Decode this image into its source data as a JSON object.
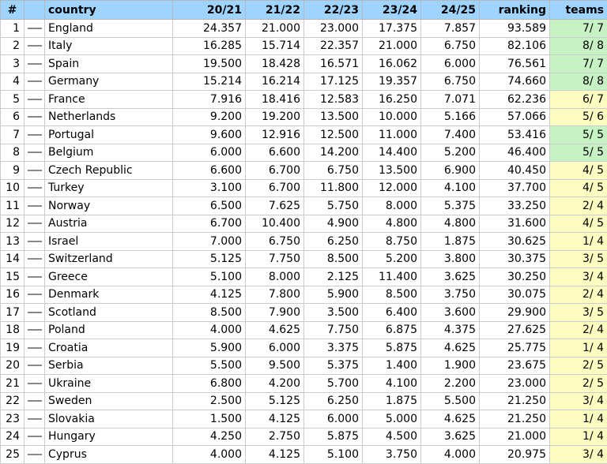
{
  "header": {
    "idx": "#",
    "country": "country",
    "s1": "20/21",
    "s2": "21/22",
    "s3": "22/23",
    "s4": "23/24",
    "s5": "24/25",
    "ranking": "ranking",
    "teams": "teams"
  },
  "colors": {
    "header": "#9fd4ff",
    "teams_green": "#c7f2c4",
    "teams_yellow": "#fdfdc2"
  },
  "trend_icon": "dash-icon",
  "rows": [
    {
      "idx": "1",
      "country": "England",
      "s1": "24.357",
      "s2": "21.000",
      "s3": "23.000",
      "s4": "17.375",
      "s5": "7.857",
      "ranking": "93.589",
      "teams": "7/ 7",
      "tc": "green"
    },
    {
      "idx": "2",
      "country": "Italy",
      "s1": "16.285",
      "s2": "15.714",
      "s3": "22.357",
      "s4": "21.000",
      "s5": "6.750",
      "ranking": "82.106",
      "teams": "8/ 8",
      "tc": "green"
    },
    {
      "idx": "3",
      "country": "Spain",
      "s1": "19.500",
      "s2": "18.428",
      "s3": "16.571",
      "s4": "16.062",
      "s5": "6.000",
      "ranking": "76.561",
      "teams": "7/ 7",
      "tc": "green"
    },
    {
      "idx": "4",
      "country": "Germany",
      "s1": "15.214",
      "s2": "16.214",
      "s3": "17.125",
      "s4": "19.357",
      "s5": "6.750",
      "ranking": "74.660",
      "teams": "8/ 8",
      "tc": "green"
    },
    {
      "idx": "5",
      "country": "France",
      "s1": "7.916",
      "s2": "18.416",
      "s3": "12.583",
      "s4": "16.250",
      "s5": "7.071",
      "ranking": "62.236",
      "teams": "6/ 7",
      "tc": "yellow"
    },
    {
      "idx": "6",
      "country": "Netherlands",
      "s1": "9.200",
      "s2": "19.200",
      "s3": "13.500",
      "s4": "10.000",
      "s5": "5.166",
      "ranking": "57.066",
      "teams": "5/ 6",
      "tc": "yellow"
    },
    {
      "idx": "7",
      "country": "Portugal",
      "s1": "9.600",
      "s2": "12.916",
      "s3": "12.500",
      "s4": "11.000",
      "s5": "7.400",
      "ranking": "53.416",
      "teams": "5/ 5",
      "tc": "green"
    },
    {
      "idx": "8",
      "country": "Belgium",
      "s1": "6.000",
      "s2": "6.600",
      "s3": "14.200",
      "s4": "14.400",
      "s5": "5.200",
      "ranking": "46.400",
      "teams": "5/ 5",
      "tc": "green"
    },
    {
      "idx": "9",
      "country": "Czech Republic",
      "s1": "6.600",
      "s2": "6.700",
      "s3": "6.750",
      "s4": "13.500",
      "s5": "6.900",
      "ranking": "40.450",
      "teams": "4/ 5",
      "tc": "yellow"
    },
    {
      "idx": "10",
      "country": "Turkey",
      "s1": "3.100",
      "s2": "6.700",
      "s3": "11.800",
      "s4": "12.000",
      "s5": "4.100",
      "ranking": "37.700",
      "teams": "4/ 5",
      "tc": "yellow"
    },
    {
      "idx": "11",
      "country": "Norway",
      "s1": "6.500",
      "s2": "7.625",
      "s3": "5.750",
      "s4": "8.000",
      "s5": "5.375",
      "ranking": "33.250",
      "teams": "2/ 4",
      "tc": "yellow"
    },
    {
      "idx": "12",
      "country": "Austria",
      "s1": "6.700",
      "s2": "10.400",
      "s3": "4.900",
      "s4": "4.800",
      "s5": "4.800",
      "ranking": "31.600",
      "teams": "4/ 5",
      "tc": "yellow"
    },
    {
      "idx": "13",
      "country": "Israel",
      "s1": "7.000",
      "s2": "6.750",
      "s3": "6.250",
      "s4": "8.750",
      "s5": "1.875",
      "ranking": "30.625",
      "teams": "1/ 4",
      "tc": "yellow"
    },
    {
      "idx": "14",
      "country": "Switzerland",
      "s1": "5.125",
      "s2": "7.750",
      "s3": "8.500",
      "s4": "5.200",
      "s5": "3.800",
      "ranking": "30.375",
      "teams": "3/ 5",
      "tc": "yellow"
    },
    {
      "idx": "15",
      "country": "Greece",
      "s1": "5.100",
      "s2": "8.000",
      "s3": "2.125",
      "s4": "11.400",
      "s5": "3.625",
      "ranking": "30.250",
      "teams": "3/ 4",
      "tc": "yellow"
    },
    {
      "idx": "16",
      "country": "Denmark",
      "s1": "4.125",
      "s2": "7.800",
      "s3": "5.900",
      "s4": "8.500",
      "s5": "3.750",
      "ranking": "30.075",
      "teams": "2/ 4",
      "tc": "yellow"
    },
    {
      "idx": "17",
      "country": "Scotland",
      "s1": "8.500",
      "s2": "7.900",
      "s3": "3.500",
      "s4": "6.400",
      "s5": "3.600",
      "ranking": "29.900",
      "teams": "3/ 5",
      "tc": "yellow"
    },
    {
      "idx": "18",
      "country": "Poland",
      "s1": "4.000",
      "s2": "4.625",
      "s3": "7.750",
      "s4": "6.875",
      "s5": "4.375",
      "ranking": "27.625",
      "teams": "2/ 4",
      "tc": "yellow"
    },
    {
      "idx": "19",
      "country": "Croatia",
      "s1": "5.900",
      "s2": "6.000",
      "s3": "3.375",
      "s4": "5.875",
      "s5": "4.625",
      "ranking": "25.775",
      "teams": "1/ 4",
      "tc": "yellow"
    },
    {
      "idx": "20",
      "country": "Serbia",
      "s1": "5.500",
      "s2": "9.500",
      "s3": "5.375",
      "s4": "1.400",
      "s5": "1.900",
      "ranking": "23.675",
      "teams": "2/ 5",
      "tc": "yellow"
    },
    {
      "idx": "21",
      "country": "Ukraine",
      "s1": "6.800",
      "s2": "4.200",
      "s3": "5.700",
      "s4": "4.100",
      "s5": "2.200",
      "ranking": "23.000",
      "teams": "2/ 5",
      "tc": "yellow"
    },
    {
      "idx": "22",
      "country": "Sweden",
      "s1": "2.500",
      "s2": "5.125",
      "s3": "6.250",
      "s4": "1.875",
      "s5": "5.500",
      "ranking": "21.250",
      "teams": "3/ 4",
      "tc": "yellow"
    },
    {
      "idx": "23",
      "country": "Slovakia",
      "s1": "1.500",
      "s2": "4.125",
      "s3": "6.000",
      "s4": "5.000",
      "s5": "4.625",
      "ranking": "21.250",
      "teams": "1/ 4",
      "tc": "yellow"
    },
    {
      "idx": "24",
      "country": "Hungary",
      "s1": "4.250",
      "s2": "2.750",
      "s3": "5.875",
      "s4": "4.500",
      "s5": "3.625",
      "ranking": "21.000",
      "teams": "1/ 4",
      "tc": "yellow"
    },
    {
      "idx": "25",
      "country": "Cyprus",
      "s1": "4.000",
      "s2": "4.125",
      "s3": "5.100",
      "s4": "3.750",
      "s5": "4.000",
      "ranking": "20.975",
      "teams": "3/ 4",
      "tc": "yellow"
    }
  ]
}
